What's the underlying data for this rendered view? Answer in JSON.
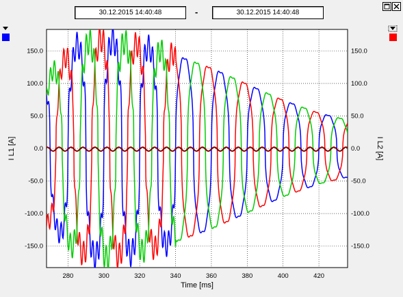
{
  "toolbar": {
    "start_time": "30.12.2015      14:40:48",
    "separator": "-",
    "end_time": "30.12.2015      14:40:48",
    "maximize_icon": "maximize-icon",
    "close_icon": "close-icon"
  },
  "colors": {
    "left_channel": "#0000ff",
    "right_channel": "#ff0000",
    "phase1": "#0000ff",
    "phase2": "#ff0000",
    "phase3": "#00cc00",
    "residual": "#800000",
    "grid": "#000000",
    "plot_bg": "#ffffff"
  },
  "chart_data": {
    "type": "line",
    "xlabel": "Time [ms]",
    "ylabel_left": "I L1 [A]",
    "ylabel_right": "I L2 [A]",
    "xlim": [
      268,
      436
    ],
    "ylim": [
      -183,
      183
    ],
    "x_ticks": [
      280,
      300,
      320,
      340,
      360,
      380,
      400,
      420
    ],
    "y_ticks": [
      150.0,
      100.0,
      50.0,
      0.0,
      -50.0,
      -100.0,
      -150.0
    ],
    "y_tick_labels": [
      "150.0",
      "100.0",
      "50.0",
      "0.0",
      "-50.0",
      "-100.0",
      "-150.0"
    ],
    "grid": true,
    "frequency_hz": 50,
    "envelope": {
      "t": [
        270,
        285,
        300,
        320,
        340,
        360,
        380,
        400,
        420,
        435
      ],
      "amplitude": [
        115,
        160,
        170,
        160,
        145,
        125,
        100,
        75,
        55,
        45
      ]
    },
    "series": [
      {
        "color": "#0000ff",
        "phase_deg": 0
      },
      {
        "color": "#ff0000",
        "phase_deg": 120
      },
      {
        "color": "#00cc00",
        "phase_deg": 240
      },
      {
        "color": "#800000",
        "phase_deg": 0
      }
    ]
  }
}
